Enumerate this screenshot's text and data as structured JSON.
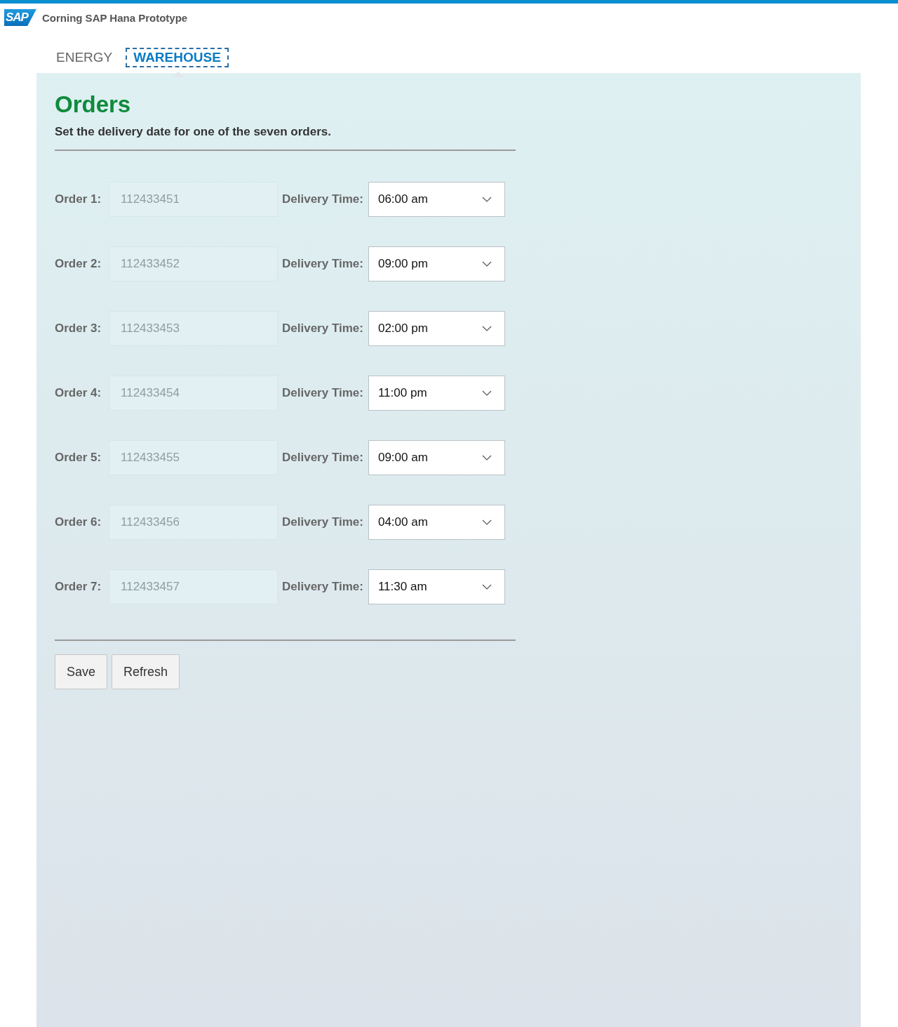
{
  "header": {
    "logo": "SAP",
    "title": "Corning SAP Hana Prototype"
  },
  "tabs": [
    {
      "label": "ENERGY",
      "selected": false
    },
    {
      "label": "WAREHOUSE",
      "selected": true
    }
  ],
  "form": {
    "title": "Orders",
    "subtitle": "Set the delivery date for one of the seven orders.",
    "orders": [
      {
        "label": "Order 1:",
        "number": "112433451",
        "disabled": true,
        "time_label": "Delivery Time:",
        "time": "06:00 am"
      },
      {
        "label": "Order 2:",
        "number": "112433452",
        "disabled": true,
        "time_label": "Delivery Time:",
        "time": "09:00 pm"
      },
      {
        "label": "Order 3:",
        "number": "112433453",
        "disabled": true,
        "time_label": "Delivery Time:",
        "time": "02:00 pm"
      },
      {
        "label": "Order 4:",
        "number": "112433454",
        "disabled": true,
        "time_label": "Delivery Time:",
        "time": "11:00 pm"
      },
      {
        "label": "Order 5:",
        "number": "112433455",
        "disabled": true,
        "time_label": "Delivery Time:",
        "time": "09:00 am"
      },
      {
        "label": "Order 6:",
        "number": "112433456",
        "disabled": true,
        "time_label": "Delivery Time:",
        "time": "04:00 am"
      },
      {
        "label": "Order 7:",
        "number": "112433457",
        "disabled": true,
        "time_label": "Delivery Time:",
        "time": "11:30 am"
      }
    ],
    "buttons": [
      "Save",
      "Refresh"
    ]
  }
}
